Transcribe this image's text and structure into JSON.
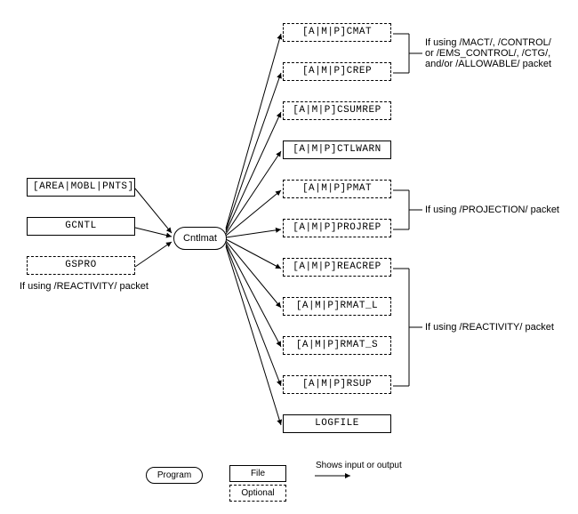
{
  "inputs": {
    "area": "[AREA|MOBL|PNTS]",
    "gcntl": "GCNTL",
    "gspro": "GSPRO",
    "gspro_note": "If using /REACTIVITY/ packet"
  },
  "program": {
    "name": "Cntlmat"
  },
  "outputs": {
    "cmat": "[A|M|P]CMAT",
    "crep": "[A|M|P]CREP",
    "csumrep": "[A|M|P]CSUMREP",
    "ctlwarn": "[A|M|P]CTLWARN",
    "pmat": "[A|M|P]PMAT",
    "projrep": "[A|M|P]PROJREP",
    "reacrep": "[A|M|P]REACREP",
    "rmat_l": "[A|M|P]RMAT_L",
    "rmat_s": "[A|M|P]RMAT_S",
    "rsup": "[A|M|P]RSUP",
    "logfile": "LOGFILE"
  },
  "annotations": {
    "top_group": "If using /MACT/, /CONTROL/\nor /EMS_CONTROL/, /CTG/,\nand/or /ALLOWABLE/ packet",
    "projection": "If using /PROJECTION/ packet",
    "reactivity": "If using /REACTIVITY/ packet"
  },
  "legend": {
    "program": "Program",
    "file": "File",
    "optional": "Optional",
    "arrow": "Shows input or output"
  }
}
